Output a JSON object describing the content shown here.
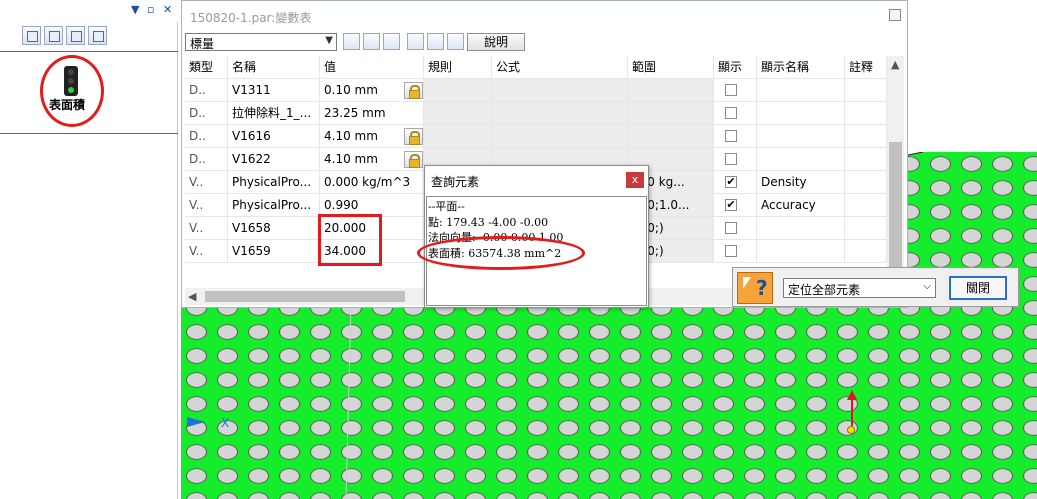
{
  "left_panel": {
    "pin_glyphs": [
      "▼",
      "▫",
      "✕"
    ],
    "feature_label": "表面積"
  },
  "window": {
    "title": "150820-1.par:變數表",
    "filter_value": "標量",
    "help_label": "說明"
  },
  "table": {
    "headers": [
      "類型",
      "名稱",
      "值",
      "規則",
      "公式",
      "範圍",
      "顯示",
      "顯示名稱",
      "註釋"
    ],
    "rows": [
      {
        "type": "D..",
        "name": "V1311",
        "value": "0.10 mm",
        "range": "",
        "locked": true,
        "checked": false,
        "display_name": ""
      },
      {
        "type": "D..",
        "name": "拉伸除料_1_...",
        "value": "23.25 mm",
        "range": "",
        "locked": false,
        "checked": false,
        "display_name": ""
      },
      {
        "type": "D..",
        "name": "V1616",
        "value": "4.10 mm",
        "range": "",
        "locked": true,
        "checked": false,
        "display_name": ""
      },
      {
        "type": "D..",
        "name": "V1622",
        "value": "4.10 mm",
        "range": "",
        "locked": true,
        "checked": false,
        "display_name": ""
      },
      {
        "type": "V..",
        "name": "PhysicalPro...",
        "value": "0.000 kg/m^3",
        "range": "000 kg...",
        "locked": false,
        "checked": true,
        "display_name": "Density"
      },
      {
        "type": "V..",
        "name": "PhysicalPro...",
        "value": "0.990",
        "range": "000;1.0...",
        "locked": false,
        "checked": true,
        "display_name": "Accuracy"
      },
      {
        "type": "V..",
        "name": "V1658",
        "value": "20.000",
        "range": "000;)",
        "locked": false,
        "checked": false,
        "display_name": ""
      },
      {
        "type": "V..",
        "name": "V1659",
        "value": "34.000",
        "range": "000;)",
        "locked": false,
        "checked": false,
        "display_name": ""
      }
    ]
  },
  "query_dialog": {
    "title": "查詢元素",
    "close_glyph": "x",
    "lines": [
      "--平面--",
      "點: 179.43 -4.00 -0.00",
      "法向向量: -0.00 0.00 1.00",
      "表面積: 63574.38 mm^2"
    ]
  },
  "locate_bar": {
    "select_value": "定位全部元素",
    "close_label": "關閉"
  },
  "viewport": {
    "triad_x_label": "X"
  },
  "colors": {
    "plate_green": "#15ec2b",
    "highlight_red": "#e21b1b",
    "lock_gold": "#e7b42a"
  }
}
